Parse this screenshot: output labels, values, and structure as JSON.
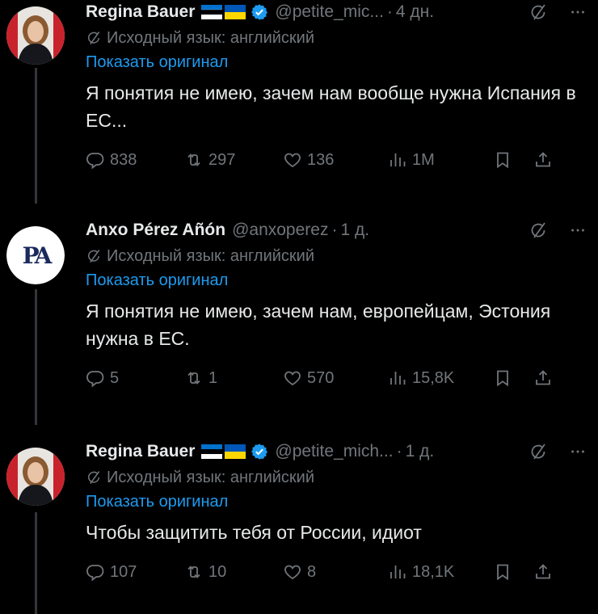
{
  "tweets": [
    {
      "author_name": "Regina Bauer",
      "handle": "@petite_mic...",
      "time": "4 дн.",
      "translated_label": "Исходный язык: английский",
      "show_original": "Показать оригинал",
      "text": "Я понятия не имею, зачем нам вообще нужна Испания в ЕС...",
      "replies": "838",
      "retweets": "297",
      "likes": "136",
      "views": "1M"
    },
    {
      "author_name": "Anxo Pérez Añón",
      "handle": "@anxoperez",
      "time": "1 д.",
      "avatar_text": "PA",
      "translated_label": "Исходный язык: английский",
      "show_original": "Показать оригинал",
      "text": "Я понятия не имею, зачем нам, европейцам, Эстония нужна в ЕС.",
      "replies": "5",
      "retweets": "1",
      "likes": "570",
      "views": "15,8K"
    },
    {
      "author_name": "Regina Bauer",
      "handle": "@petite_mich...",
      "time": "1 д.",
      "translated_label": "Исходный язык: английский",
      "show_original": "Показать оригинал",
      "text": "Чтобы защитить тебя от России, идиот",
      "replies": "107",
      "retweets": "10",
      "likes": "8",
      "views": "18,1K"
    }
  ],
  "dot": "·",
  "colors": {
    "background": "#000000",
    "text": "#e7e9ea",
    "muted": "#71767b",
    "link": "#1d9bf0",
    "verified": "#1d9bf0"
  },
  "icons": [
    "grok-icon",
    "more-icon",
    "translate-icon",
    "reply-icon",
    "retweet-icon",
    "like-icon",
    "views-icon",
    "bookmark-icon",
    "share-icon",
    "verified-badge-icon",
    "estonia-flag-icon",
    "ukraine-flag-icon"
  ]
}
